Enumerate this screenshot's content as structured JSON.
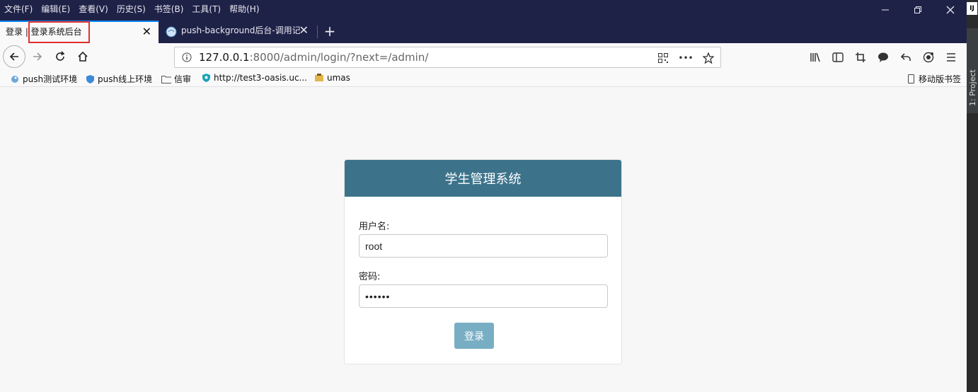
{
  "menu": [
    "文件(F)",
    "编辑(E)",
    "查看(V)",
    "历史(S)",
    "书签(B)",
    "工具(T)",
    "帮助(H)"
  ],
  "tabs": [
    {
      "title": "登录 | 登录系统后台",
      "active": true
    },
    {
      "title": "push-background后台-调用记",
      "active": false
    }
  ],
  "url": {
    "host": "127.0.0.1",
    "rest": ":8000/admin/login/?next=/admin/"
  },
  "bookmarks": [
    "push测试环境",
    "push线上环境",
    "信审",
    "http://test3-oasis.uc...",
    "umas",
    "移动版书签"
  ],
  "side": {
    "badge": "IJ",
    "project_label": "1: Project"
  },
  "login": {
    "title": "学生管理系统",
    "username_label": "用户名:",
    "username_value": "root",
    "password_label": "密码:",
    "password_value": "••••••",
    "submit_label": "登录"
  },
  "colors": {
    "header": "#3c738b",
    "button": "#78aec4",
    "chrome_dark": "#1f2247",
    "highlight": "#e0302c"
  }
}
